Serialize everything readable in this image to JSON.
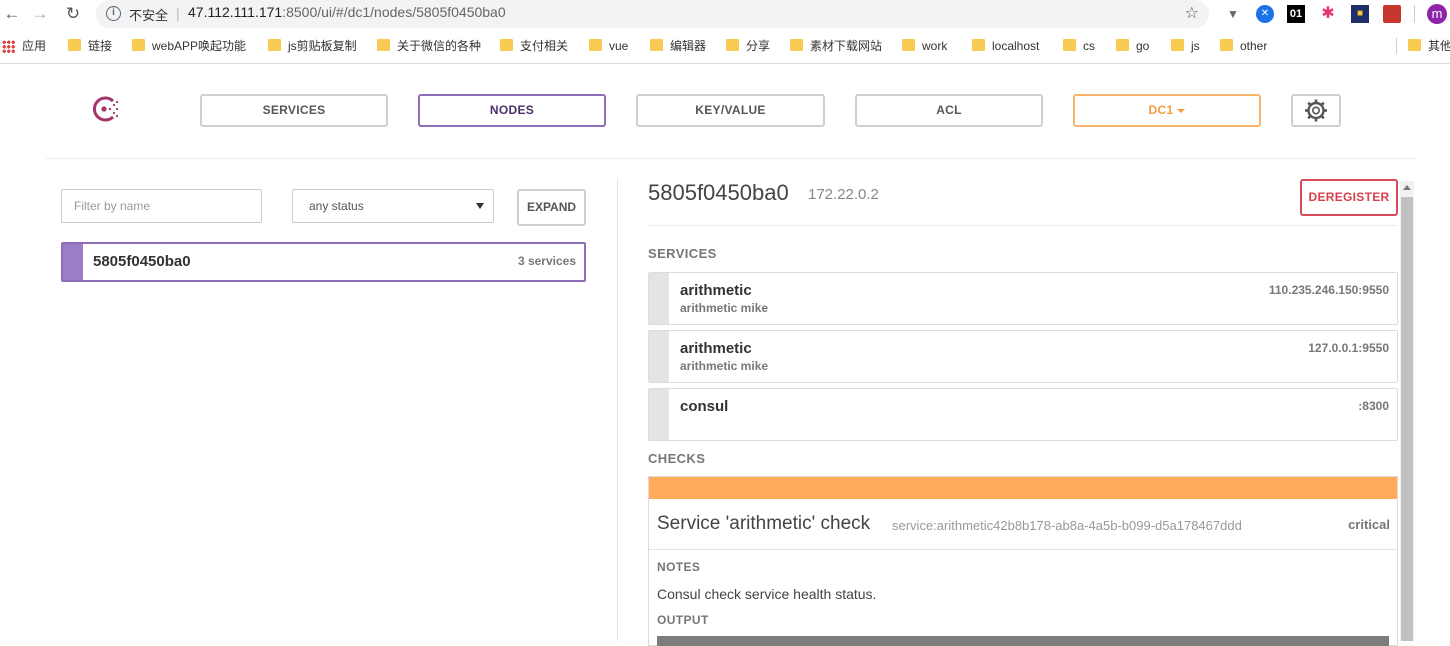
{
  "browser": {
    "insecure_label": "不安全",
    "url_host": "47.112.111.171",
    "url_rest": ":8500/ui/#/dc1/nodes/5805f0450ba0",
    "bookmarks": [
      "应用",
      "链接",
      "webAPP唤起功能",
      "js剪贴板复制",
      "关于微信的各种",
      "支付相关",
      "vue",
      "编辑器",
      "分享",
      "素材下载网站",
      "work",
      "localhost",
      "cs",
      "go",
      "js",
      "other",
      "其他"
    ],
    "extension_labels": {
      "ext_01": "01",
      "profile": "m"
    }
  },
  "header": {
    "nav": [
      "SERVICES",
      "NODES",
      "KEY/VALUE",
      "ACL"
    ],
    "datacenter": "DC1",
    "active": "NODES"
  },
  "filter": {
    "placeholder": "Filter by name",
    "status_value": "any status",
    "expand_label": "EXPAND"
  },
  "nodes": [
    {
      "name": "5805f0450ba0",
      "services_count": "3 services"
    }
  ],
  "detail": {
    "node_name": "5805f0450ba0",
    "node_ip": "172.22.0.2",
    "deregister_label": "DEREGISTER",
    "services_heading": "SERVICES",
    "services": [
      {
        "name": "arithmetic",
        "tags": "arithmetic mike",
        "address": "110.235.246.150:9550"
      },
      {
        "name": "arithmetic",
        "tags": "arithmetic mike",
        "address": "127.0.0.1:9550"
      },
      {
        "name": "consul",
        "tags": "",
        "address": ":8300"
      }
    ],
    "checks_heading": "CHECKS",
    "check": {
      "title": "Service 'arithmetic' check",
      "id": "service:arithmetic42b8b178-ab8a-4a5b-b099-d5a178467ddd",
      "status": "critical",
      "status_color": "#ffab5a",
      "notes_label": "NOTES",
      "notes": "Consul check service health status.",
      "output_label": "OUTPUT"
    }
  }
}
